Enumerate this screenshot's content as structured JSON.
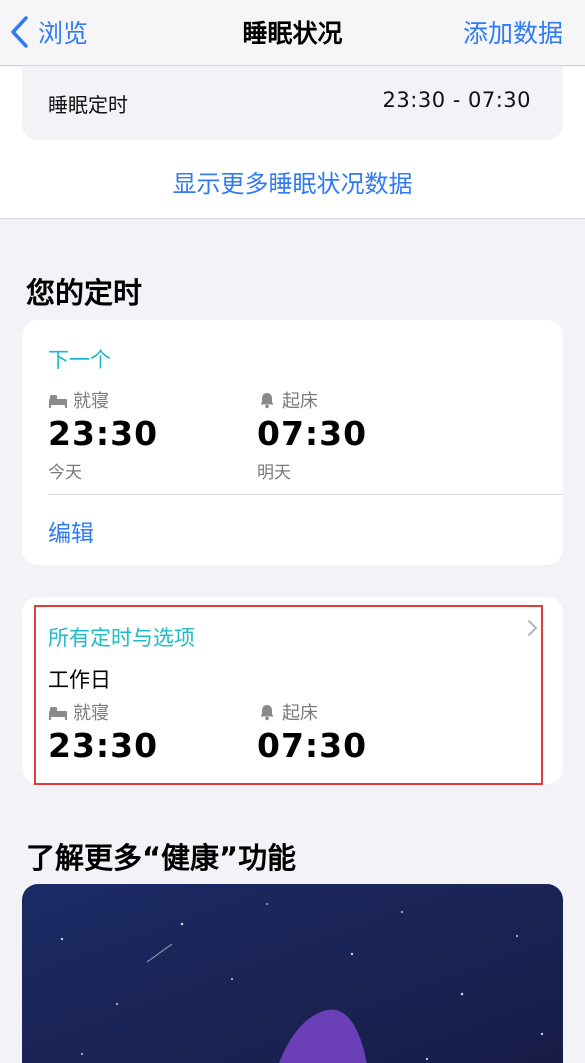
{
  "nav": {
    "back_label": "浏览",
    "title": "睡眠状况",
    "action_label": "添加数据"
  },
  "sleep_schedule": {
    "label": "睡眠定时",
    "value": "23:30 - 07:30"
  },
  "more_link": "显示更多睡眠状况数据",
  "your_schedules": {
    "title": "您的定时",
    "next": {
      "heading": "下一个",
      "bedtime_label": "就寝",
      "bedtime": "23:30",
      "bedtime_day": "今天",
      "wake_label": "起床",
      "wake": "07:30",
      "wake_day": "明天",
      "edit_label": "编辑"
    },
    "all": {
      "heading": "所有定时与选项",
      "schedule_name": "工作日",
      "bedtime_label": "就寝",
      "bedtime": "23:30",
      "wake_label": "起床",
      "wake": "07:30"
    }
  },
  "learn_more": {
    "title": "了解更多“健康”功能"
  },
  "colors": {
    "accent": "#2f7bf5",
    "teal": "#1bbcc8",
    "highlight": "#e33b3b",
    "background": "#f2f2f7"
  }
}
